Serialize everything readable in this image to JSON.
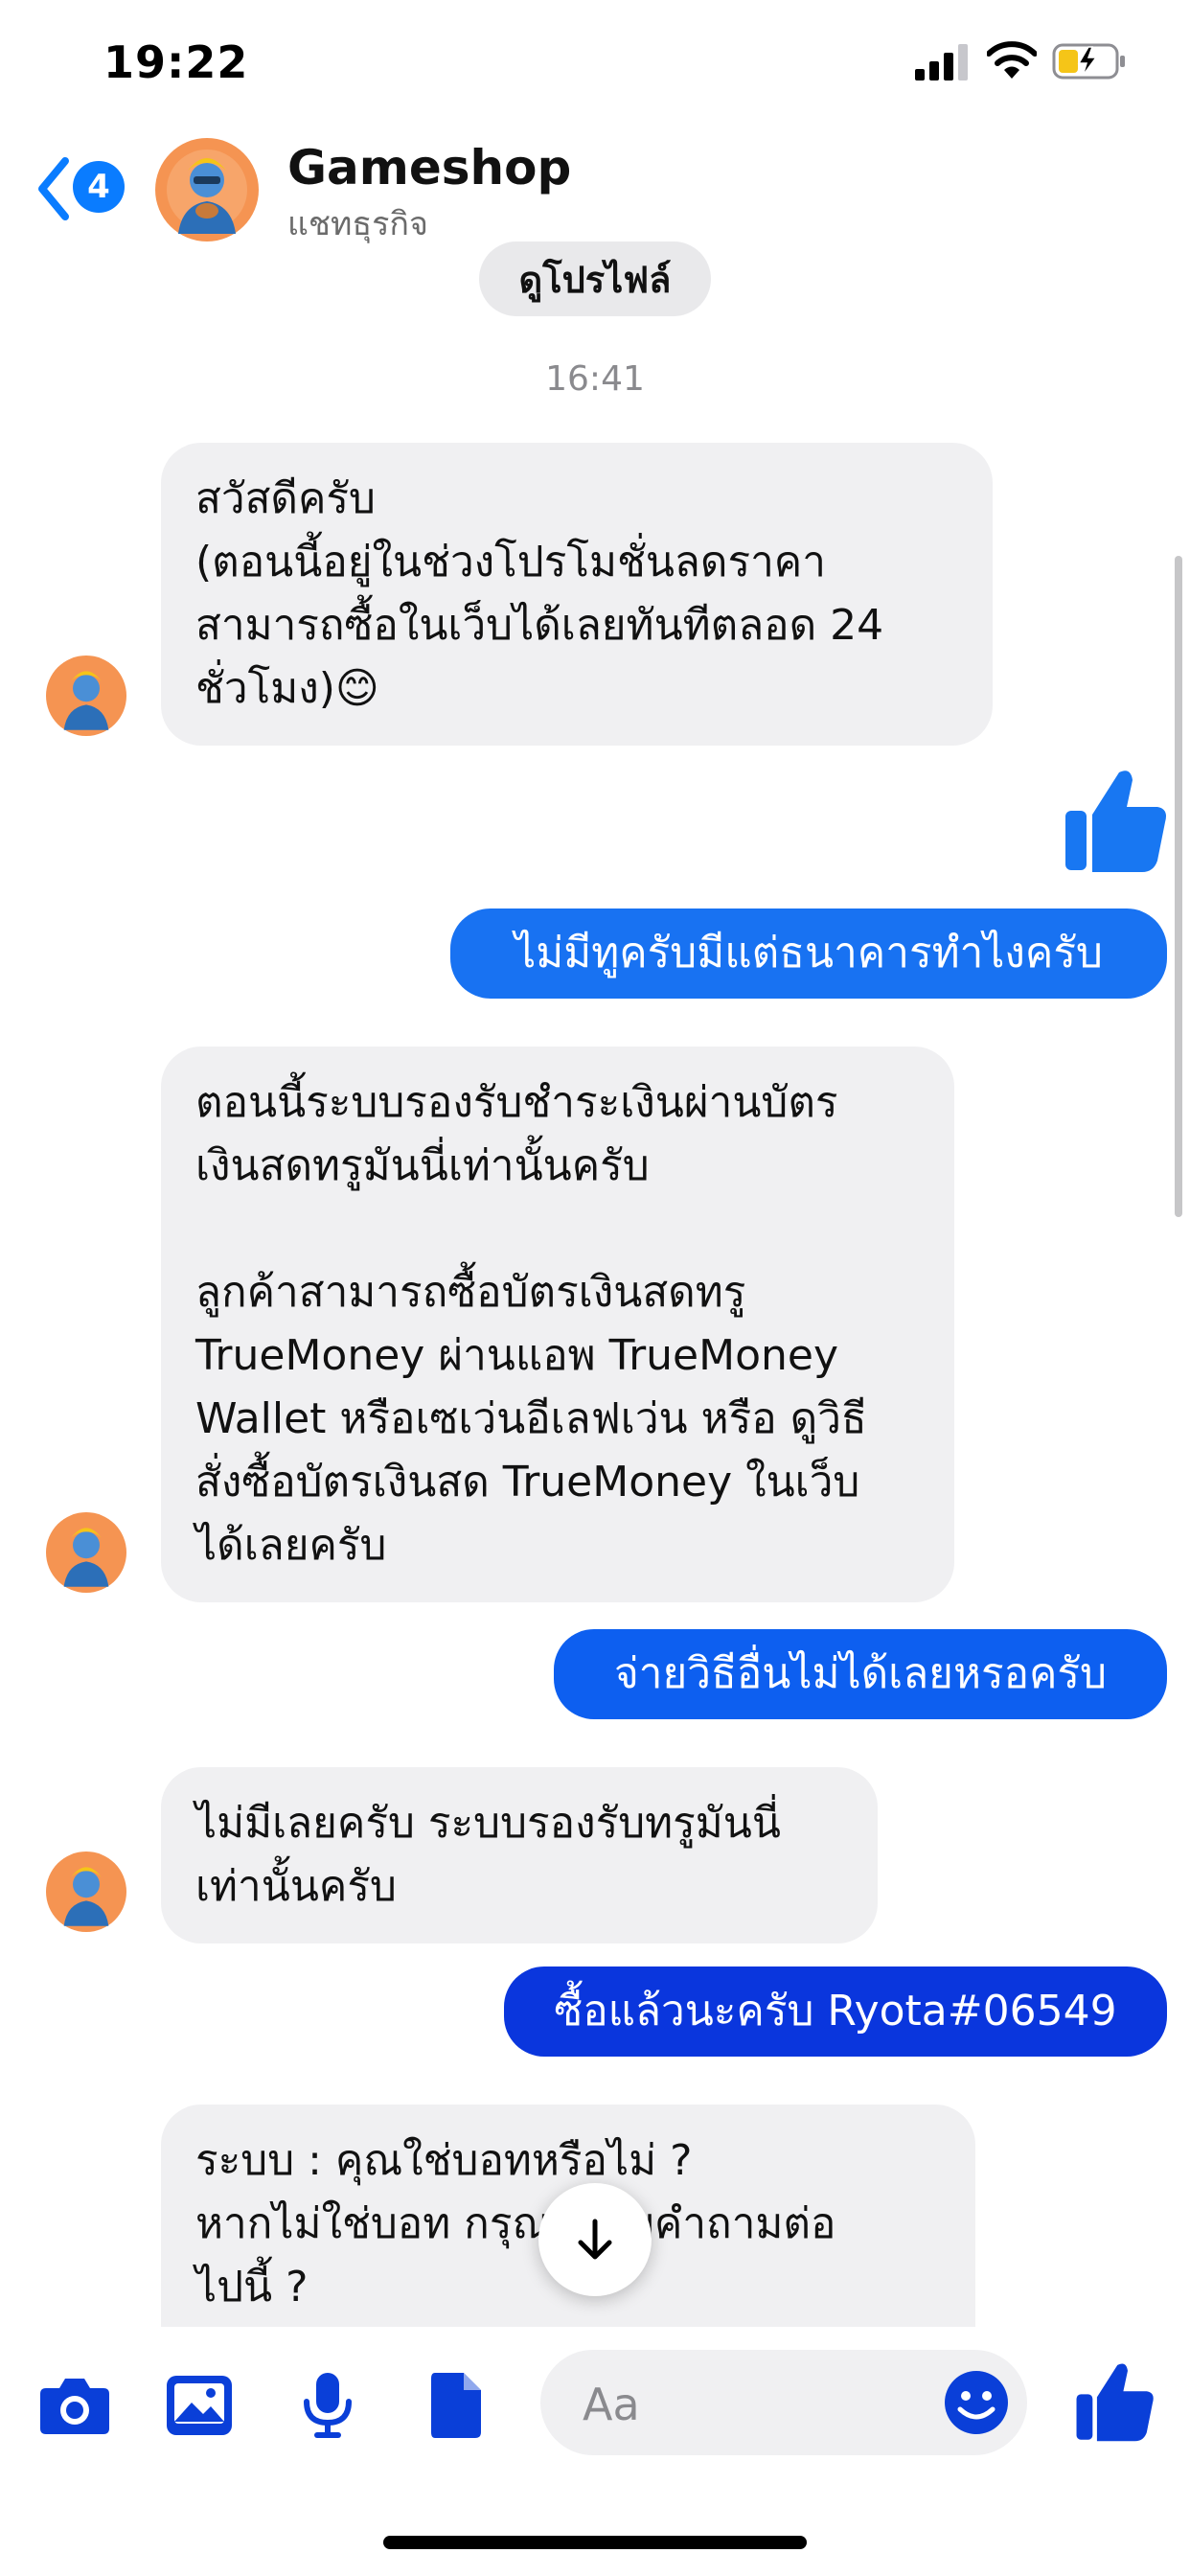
{
  "status_bar": {
    "time": "19:22"
  },
  "header": {
    "back_count": "4",
    "name": "Gameshop",
    "subtitle": "แชทธุรกิจ",
    "view_profile": "ดูโปรไฟล์"
  },
  "timestamp": "16:41",
  "messages": [
    {
      "from": "shop",
      "text": "สวัสดีครับ\n(ตอนนี้อยู่ในช่วงโปรโมชั่นลดราคา\nสามารถซื้อในเว็บได้เลยทันทีตลอด 24\nชั่วโมง)😊"
    },
    {
      "from": "me",
      "text": "👍"
    },
    {
      "from": "me",
      "text": "ไม่มีทูครับมีแต่ธนาคารทำไงครับ"
    },
    {
      "from": "shop",
      "text": "ตอนนี้ระบบรองรับชำระเงินผ่านบัตร\nเงินสดทรูมันนี่เท่านั้นครับ\n\nลูกค้าสามารถซื้อบัตรเงินสดทรู\nTrueMoney ผ่านแอพ TrueMoney\nWallet หรือเซเว่นอีเลฟเว่น หรือ ดูวิธี\nสั่งซื้อบัตรเงินสด TrueMoney ในเว็บ\nได้เลยครับ"
    },
    {
      "from": "me",
      "text": "จ่ายวิธีอื่นไม่ได้เลยหรอครับ"
    },
    {
      "from": "shop",
      "text": "ไม่มีเลยครับ ระบบรองรับทรูมันนี่\nเท่านั้นครับ"
    },
    {
      "from": "me",
      "text": "ซื้อแล้วนะครับ Ryota#06549"
    },
    {
      "from": "shop",
      "text": "ระบบ : คุณใช่บอทหรือไม่ ?\nหากไม่ใช่บอท กรุณาตอบคำถามต่อ\nไปนี้ ?"
    }
  ],
  "composer": {
    "placeholder": "Aa"
  },
  "colors": {
    "accent": "#0a7cff",
    "outgoing_top": "#1877f2",
    "outgoing_bottom": "#0a2fdc",
    "incoming_bg": "#f0f0f2",
    "avatar_bg": "#f59452"
  },
  "icons": [
    "signal-icon",
    "wifi-icon",
    "battery-charging-icon",
    "back-chevron-icon",
    "camera-icon",
    "gallery-icon",
    "microphone-icon",
    "file-icon",
    "emoji-icon",
    "thumbs-up-icon",
    "arrow-down-icon"
  ]
}
